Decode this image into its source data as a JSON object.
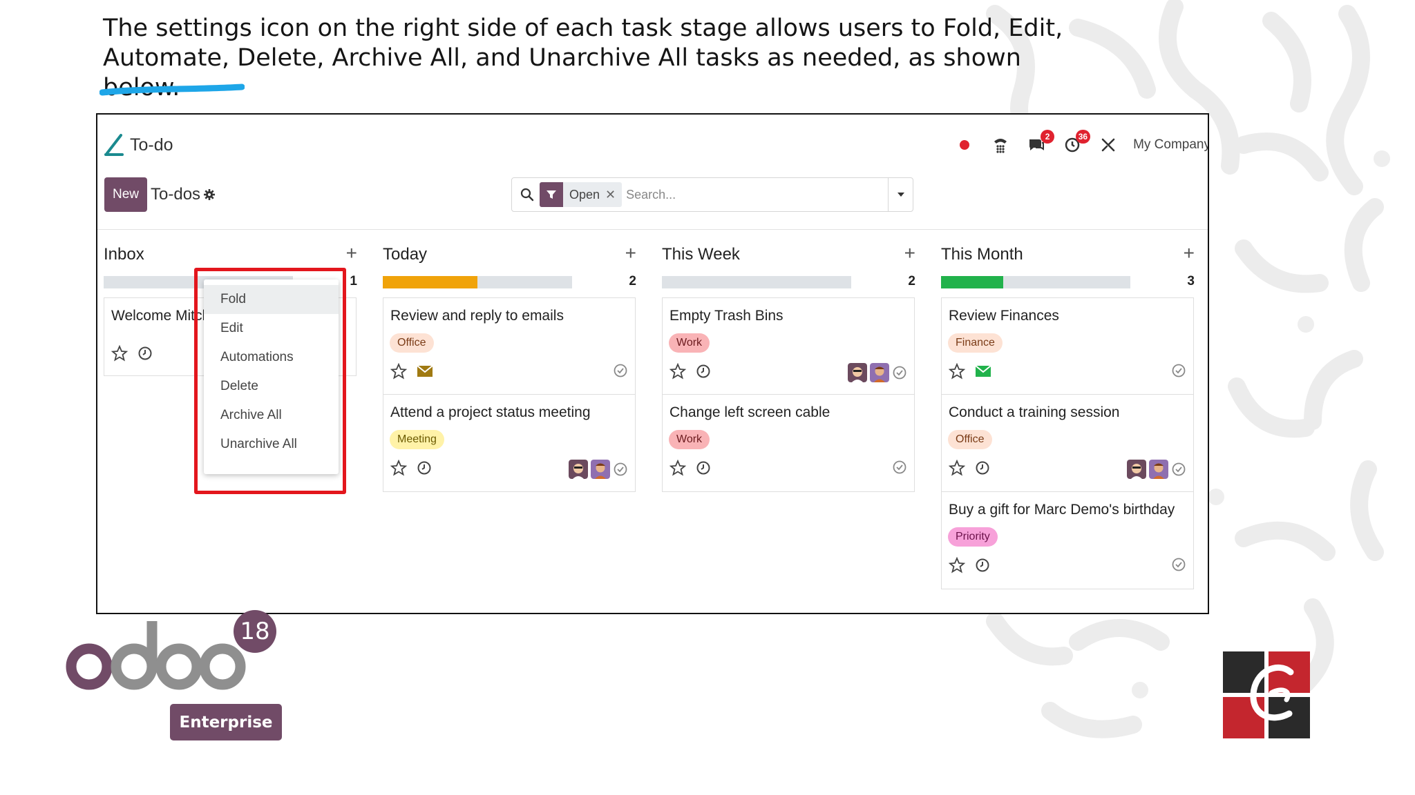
{
  "slide": {
    "caption": "The settings icon on the right side of each task stage allows users to Fold, Edit, Automate, Delete, Archive All, and Unarchive All tasks as needed, as shown below."
  },
  "app": {
    "title": "To-do",
    "company": "My Company",
    "messages_badge": "2",
    "activities_badge": "36"
  },
  "control": {
    "new_label": "New",
    "breadcrumb": "To-dos",
    "facet_label": "Open",
    "facet_remove": "✕",
    "search_placeholder": "Search..."
  },
  "columns": [
    {
      "title": "Inbox",
      "count": "1",
      "progress": 0.0,
      "progress_color": "#dee2e6",
      "cards": [
        {
          "title": "Welcome Mitchell"
        }
      ]
    },
    {
      "title": "Today",
      "count": "2",
      "progress": 0.5,
      "progress_color": "#f0a30a",
      "cards": [
        {
          "title": "Review and reply to emails",
          "tag": "Office",
          "tag_bg": "#fde2d4",
          "tag_fg": "#7a3b16",
          "icon": "envelope-icon"
        },
        {
          "title": "Attend a project status meeting",
          "tag": "Meeting",
          "tag_bg": "#fff2a8",
          "tag_fg": "#6b5a00",
          "icon": "clock-icon",
          "avatars": 2
        }
      ]
    },
    {
      "title": "This Week",
      "count": "2",
      "progress": 0.0,
      "progress_color": "#dee2e6",
      "cards": [
        {
          "title": "Empty Trash Bins",
          "tag": "Work",
          "tag_bg": "#f9b3b6",
          "tag_fg": "#6b1a1e",
          "icon": "clock-icon",
          "avatars": 2
        },
        {
          "title": "Change left screen cable",
          "tag": "Work",
          "tag_bg": "#f9b3b6",
          "tag_fg": "#6b1a1e",
          "icon": "clock-icon"
        }
      ]
    },
    {
      "title": "This Month",
      "count": "3",
      "progress": 0.33,
      "progress_color": "#21b24b",
      "cards": [
        {
          "title": "Review Finances",
          "tag": "Finance",
          "tag_bg": "#fde2d4",
          "tag_fg": "#7a3b16",
          "icon": "envelope-icon"
        },
        {
          "title": "Conduct a training session",
          "tag": "Office",
          "tag_bg": "#fde2d4",
          "tag_fg": "#7a3b16",
          "icon": "clock-icon",
          "avatars": 2
        },
        {
          "title": "Buy a gift for Marc Demo's birthday",
          "tag": "Priority",
          "tag_bg": "#f7a1d9",
          "tag_fg": "#6b114a",
          "icon": "clock-icon"
        }
      ]
    }
  ],
  "dropdown": {
    "items": [
      "Fold",
      "Edit",
      "Automations",
      "Delete",
      "Archive All",
      "Unarchive All"
    ]
  },
  "branding": {
    "version": "18",
    "edition": "Enterprise"
  },
  "colors": {
    "primary": "#714b67",
    "highlight": "#e3161d",
    "underline": "#1ea6e8"
  }
}
